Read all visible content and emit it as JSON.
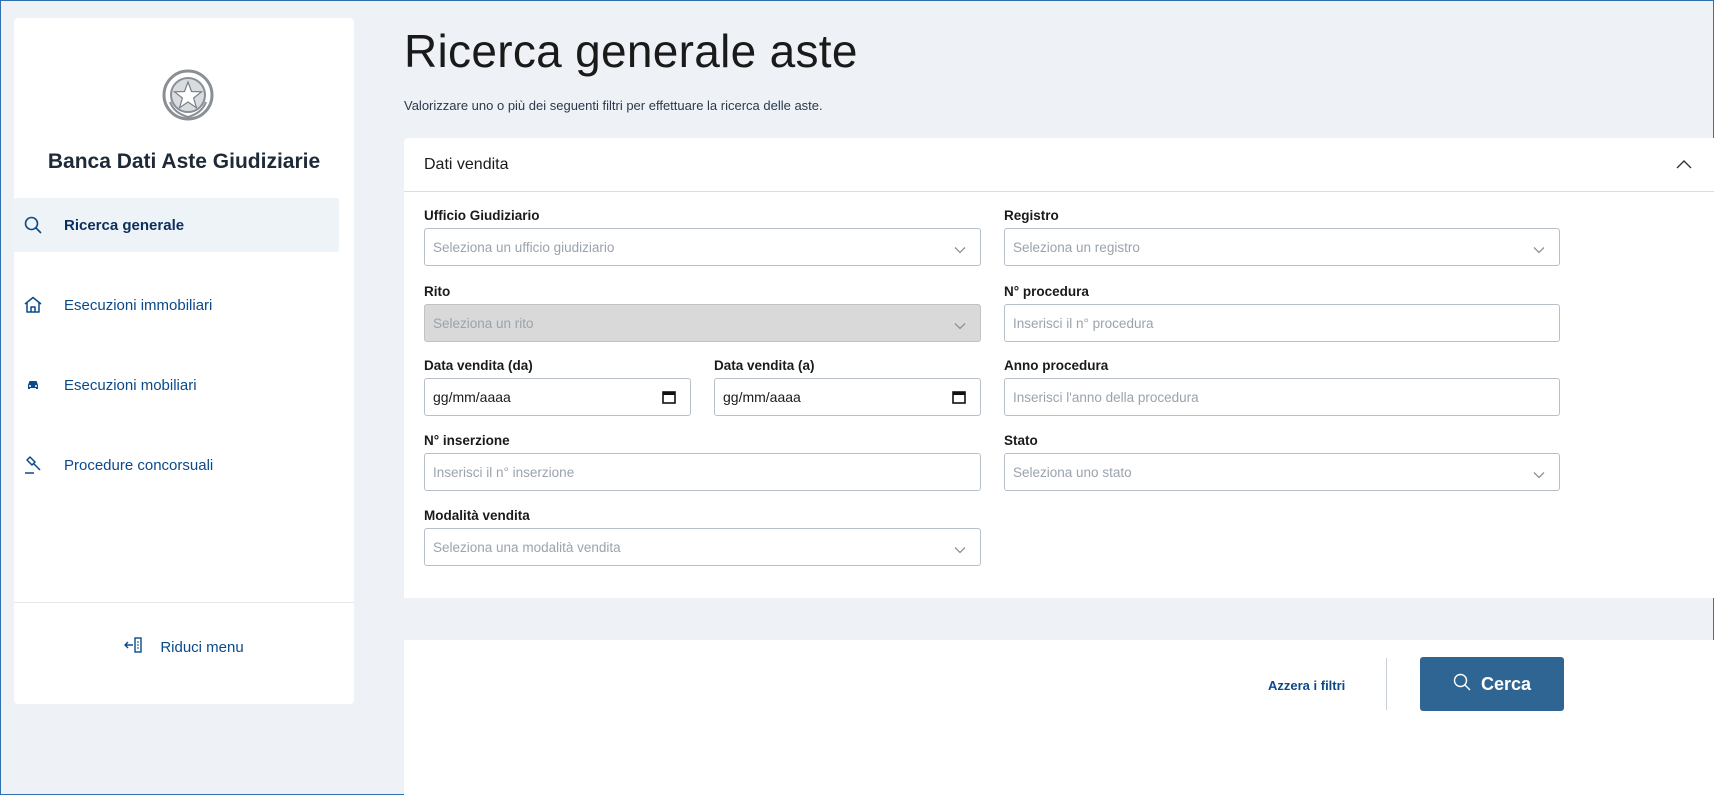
{
  "sidebar": {
    "brand": "Banca Dati Aste Giudiziarie",
    "items": [
      {
        "label": "Ricerca generale",
        "icon": "search-icon",
        "active": true
      },
      {
        "label": "Esecuzioni immobiliari",
        "icon": "house-icon",
        "active": false
      },
      {
        "label": "Esecuzioni mobiliari",
        "icon": "car-icon",
        "active": false
      },
      {
        "label": "Procedure concorsuali",
        "icon": "gavel-icon",
        "active": false
      }
    ],
    "collapse_label": "Riduci menu"
  },
  "main": {
    "title": "Ricerca generale aste",
    "subtitle": "Valorizzare uno o più dei seguenti filtri per effettuare la ricerca delle aste.",
    "panel": {
      "title": "Dati vendita",
      "fields": {
        "ufficio": {
          "label": "Ufficio Giudiziario",
          "placeholder": "Seleziona un ufficio giudiziario"
        },
        "registro": {
          "label": "Registro",
          "placeholder": "Seleziona un registro"
        },
        "rito": {
          "label": "Rito",
          "placeholder": "Seleziona un rito"
        },
        "procedura": {
          "label": "N° procedura",
          "placeholder": "Inserisci il n° procedura"
        },
        "data_da": {
          "label": "Data vendita (da)",
          "value": "gg/mm/aaaa"
        },
        "data_a": {
          "label": "Data vendita (a)",
          "value": "gg/mm/aaaa"
        },
        "anno": {
          "label": "Anno procedura",
          "placeholder": "Inserisci l'anno della procedura"
        },
        "inserzione": {
          "label": "N° inserzione",
          "placeholder": "Inserisci il n° inserzione"
        },
        "stato": {
          "label": "Stato",
          "placeholder": "Seleziona uno stato"
        },
        "modalita": {
          "label": "Modalità vendita",
          "placeholder": "Seleziona una modalità vendita"
        }
      }
    },
    "actions": {
      "reset_label": "Azzera i filtri",
      "search_label": "Cerca"
    }
  },
  "colors": {
    "accent": "#2f6593",
    "link": "#0b4a8a",
    "background": "#eef2f7"
  }
}
